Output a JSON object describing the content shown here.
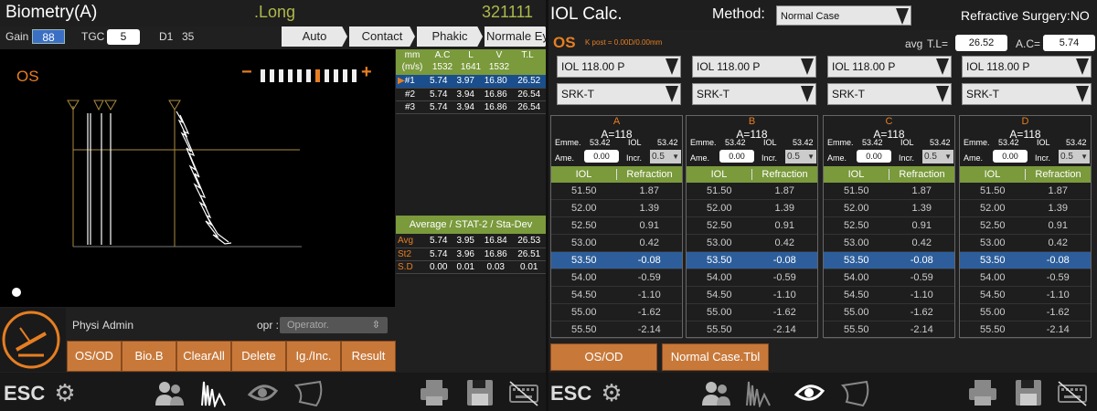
{
  "left": {
    "title": "Biometry(A)",
    "mode": ".Long",
    "patient_id": "321111",
    "gain_label": "Gain",
    "gain_value": "88",
    "tgc_label": "TGC",
    "tgc_value": "5",
    "d1_label": "D1",
    "d1_value": "35",
    "chevrons": [
      "Auto",
      "Contact",
      "Phakic",
      "Normale Ey"
    ],
    "eye_label": "OS",
    "table_head": {
      "unit1": "mm",
      "unit2": "(m/s)",
      "cols": [
        "A.C",
        "L",
        "V",
        "T.L"
      ],
      "speeds": [
        "1532",
        "1641",
        "1532",
        ""
      ]
    },
    "rows": [
      {
        "id": "#1",
        "ac": "5.74",
        "l": "3.97",
        "v": "16.80",
        "tl": "26.52"
      },
      {
        "id": "#2",
        "ac": "5.74",
        "l": "3.94",
        "v": "16.86",
        "tl": "26.54"
      },
      {
        "id": "#3",
        "ac": "5.74",
        "l": "3.94",
        "v": "16.86",
        "tl": "26.54"
      }
    ],
    "stats_title": "Average / STAT-2 / Sta-Dev",
    "stats": [
      {
        "label": "Avg",
        "ac": "5.74",
        "l": "3.95",
        "v": "16.84",
        "tl": "26.53"
      },
      {
        "label": "St2",
        "ac": "5.74",
        "l": "3.96",
        "v": "16.86",
        "tl": "26.51"
      },
      {
        "label": "S.D",
        "ac": "0.00",
        "l": "0.01",
        "v": "0.03",
        "tl": "0.01"
      }
    ],
    "physi_label": "Physi",
    "admin_label": "Admin",
    "opr_label": "opr :",
    "opr_placeholder": "Operator.",
    "buttons": [
      "OS/OD",
      "Bio.B",
      "ClearAll",
      "Delete",
      "Ig./Inc.",
      "Result"
    ],
    "esc": "ESC",
    "zoom_minus": "−",
    "zoom_plus": "+"
  },
  "right": {
    "title": "IOL Calc.",
    "method_label": "Method:",
    "method_value": "Normal Case",
    "refr_surgery": "Refractive Surgery:NO",
    "eye_label": "OS",
    "kpost": "K post = 0.00D/0.00mm",
    "avg_label": "avg",
    "tl_label": "T.L=",
    "tl_value": "26.52",
    "ac_label": "A.C=",
    "ac_value": "5.74",
    "lens": "IOL 118.00 P",
    "formula": "SRK-T",
    "columns": [
      {
        "letter": "A",
        "aconst": "A=118",
        "emme": "53.42",
        "iol": "53.42",
        "ame": "0.00",
        "incr": "0.5"
      },
      {
        "letter": "B",
        "aconst": "A=118",
        "emme": "53.42",
        "iol": "53.42",
        "ame": "0.00",
        "incr": "0.5"
      },
      {
        "letter": "C",
        "aconst": "A=118",
        "emme": "53.42",
        "iol": "53.42",
        "ame": "0.00",
        "incr": "0.5"
      },
      {
        "letter": "D",
        "aconst": "A=118",
        "emme": "53.42",
        "iol": "53.42",
        "ame": "0.00",
        "incr": "0.5"
      }
    ],
    "emme_label": "Emme.",
    "iol_label": "IOL",
    "ame_label": "Ame.",
    "incr_label": "Incr.",
    "col_iol": "IOL",
    "col_refr": "Refraction",
    "iol_rows": [
      "51.50",
      "52.00",
      "52.50",
      "53.00",
      "53.50",
      "54.00",
      "54.50",
      "55.00",
      "55.50"
    ],
    "refr_rows": [
      "1.87",
      "1.39",
      "0.91",
      "0.42",
      "-0.08",
      "-0.59",
      "-1.10",
      "-1.62",
      "-2.14"
    ],
    "buttons": [
      "OS/OD",
      "Normal Case.Tbl"
    ],
    "esc": "ESC"
  }
}
